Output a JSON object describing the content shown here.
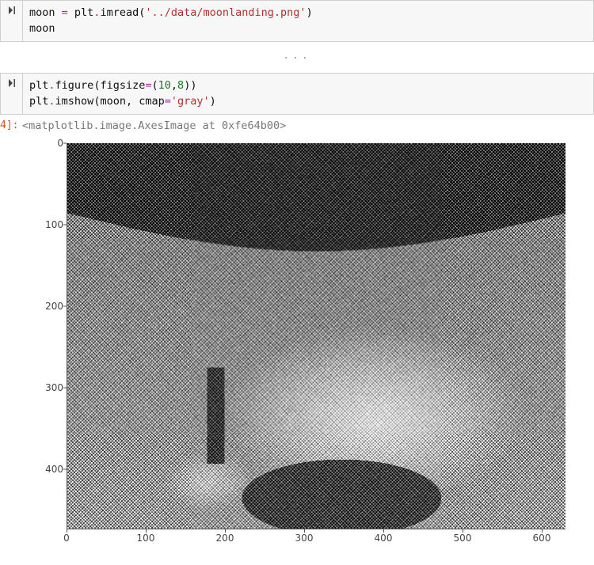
{
  "cell1": {
    "line1": {
      "a": "moon ",
      "op1": "=",
      "b": " plt",
      "dot1": ".",
      "c": "imread",
      "p1": "(",
      "s": "'../data/moonlanding.png'",
      "p2": ")"
    },
    "line2": "moon"
  },
  "ellipsis": "...",
  "cell2": {
    "line1": {
      "a": "plt",
      "dot1": ".",
      "b": "figure",
      "p1": "(",
      "kw": "figsize",
      "op1": "=",
      "p2": "(",
      "n1": "10",
      "comma": ",",
      "n2": "8",
      "p3": ")",
      "p4": ")"
    },
    "line2": {
      "a": "plt",
      "dot1": ".",
      "b": "imshow",
      "p1": "(",
      "c": "moon",
      "comma": ", ",
      "kw": "cmap",
      "op1": "=",
      "s": "'gray'",
      "p2": ")"
    }
  },
  "output": {
    "prompt": "4]:",
    "text": "<matplotlib.image.AxesImage at 0xfe64b00>"
  },
  "chart_data": {
    "type": "heatmap",
    "title": "",
    "xlabel": "",
    "ylabel": "",
    "cmap": "gray",
    "xlim": [
      0,
      630
    ],
    "ylim": [
      0,
      474
    ],
    "xticks": [
      0,
      100,
      200,
      300,
      400,
      500,
      600
    ],
    "yticks": [
      0,
      100,
      200,
      300,
      400
    ],
    "description": "Noisy grayscale image of the Moon landing photograph (astronaut on lunar surface with lunar module), corrupted with high-frequency periodic noise pattern. Darker sky in upper region, lunar terrain and module in lower two-thirds."
  }
}
